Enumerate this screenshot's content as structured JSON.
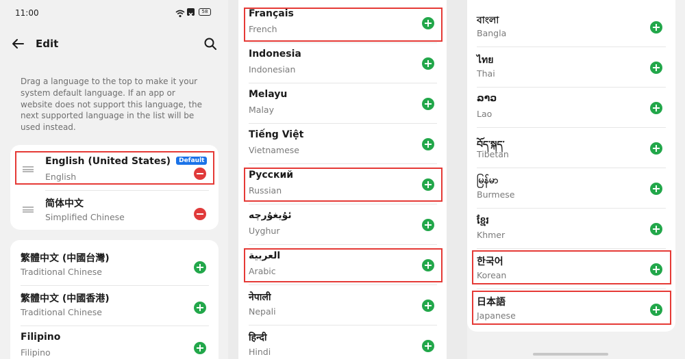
{
  "status_bar": {
    "time": "11:00",
    "battery": "58"
  },
  "header": {
    "title": "Edit"
  },
  "info_text": "Drag a language to the top to make it your system default language. If an app or website does not support this language, the next supported language in the list will be used instead.",
  "selected": [
    {
      "name": "English (United States)",
      "sub": "English",
      "badge": "Default"
    },
    {
      "name": "简体中文",
      "sub": "Simplified Chinese"
    }
  ],
  "available_col1": [
    {
      "name": "繁體中文 (中國台灣)",
      "sub": "Traditional Chinese"
    },
    {
      "name": "繁體中文 (中國香港)",
      "sub": "Traditional Chinese"
    },
    {
      "name": "Filipino",
      "sub": "Filipino"
    }
  ],
  "available_col2": [
    {
      "name": "Français",
      "sub": "French"
    },
    {
      "name": "Indonesia",
      "sub": "Indonesian"
    },
    {
      "name": "Melayu",
      "sub": "Malay"
    },
    {
      "name": "Tiếng Việt",
      "sub": "Vietnamese"
    },
    {
      "name": "Русский",
      "sub": "Russian"
    },
    {
      "name": "ئۇيغۇرچە",
      "sub": "Uyghur"
    },
    {
      "name": "العربية",
      "sub": "Arabic"
    },
    {
      "name": "नेपाली",
      "sub": "Nepali"
    },
    {
      "name": "हिन्दी",
      "sub": "Hindi"
    }
  ],
  "available_col3": [
    {
      "name": "বাংলা",
      "sub": "Bangla"
    },
    {
      "name": "ไทย",
      "sub": "Thai"
    },
    {
      "name": "ລາວ",
      "sub": "Lao"
    },
    {
      "name": "བོད་སྐད་",
      "sub": "Tibetan"
    },
    {
      "name": "မြန်မာ",
      "sub": "Burmese"
    },
    {
      "name": "ខ្មែរ",
      "sub": "Khmer"
    },
    {
      "name": "한국어",
      "sub": "Korean"
    },
    {
      "name": "日本語",
      "sub": "Japanese"
    }
  ],
  "colors": {
    "add": "#22a74a",
    "remove": "#e03a3a",
    "highlight": "#e53935",
    "badge": "#1b73e8"
  }
}
